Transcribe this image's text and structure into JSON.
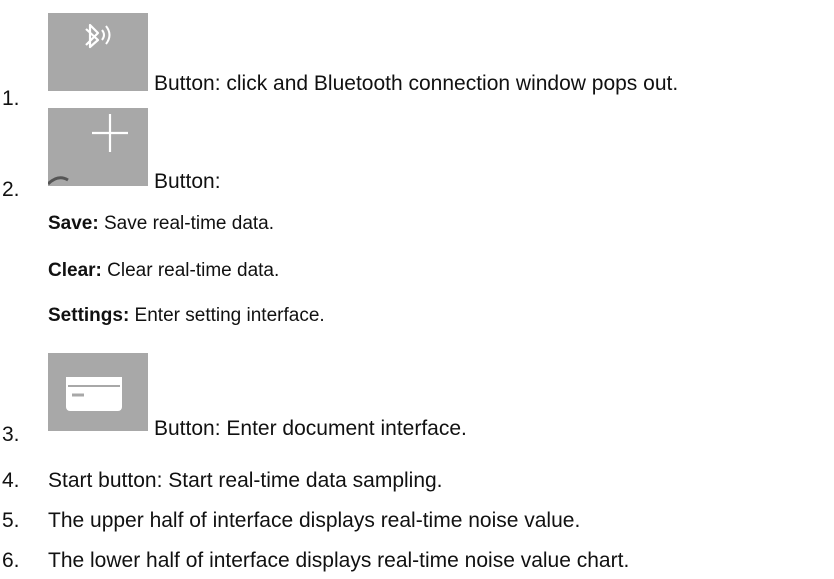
{
  "items": [
    {
      "number": "1.",
      "icon": "bluetooth-icon",
      "text": "Button: click and Bluetooth connection window pops out."
    },
    {
      "number": "2.",
      "icon": "plus-icon",
      "text": "Button:",
      "subitems": [
        {
          "term": "Save:",
          "desc": " Save real-time data."
        },
        {
          "term": "Clear:",
          "desc": " Clear real-time data."
        },
        {
          "term": "Settings:",
          "desc": " Enter setting interface."
        }
      ]
    },
    {
      "number": "3.",
      "icon": "document-icon",
      "text": "Button: Enter document interface."
    },
    {
      "number": "4.",
      "text": "Start button: Start real-time data sampling."
    },
    {
      "number": "5.",
      "text": "The upper half of interface displays real-time noise value."
    },
    {
      "number": "6.",
      "text": "The lower half of interface displays real-time noise value chart."
    }
  ],
  "colors": {
    "icon_tile": "#a8a8a8",
    "icon_glyph": "#ffffff"
  }
}
